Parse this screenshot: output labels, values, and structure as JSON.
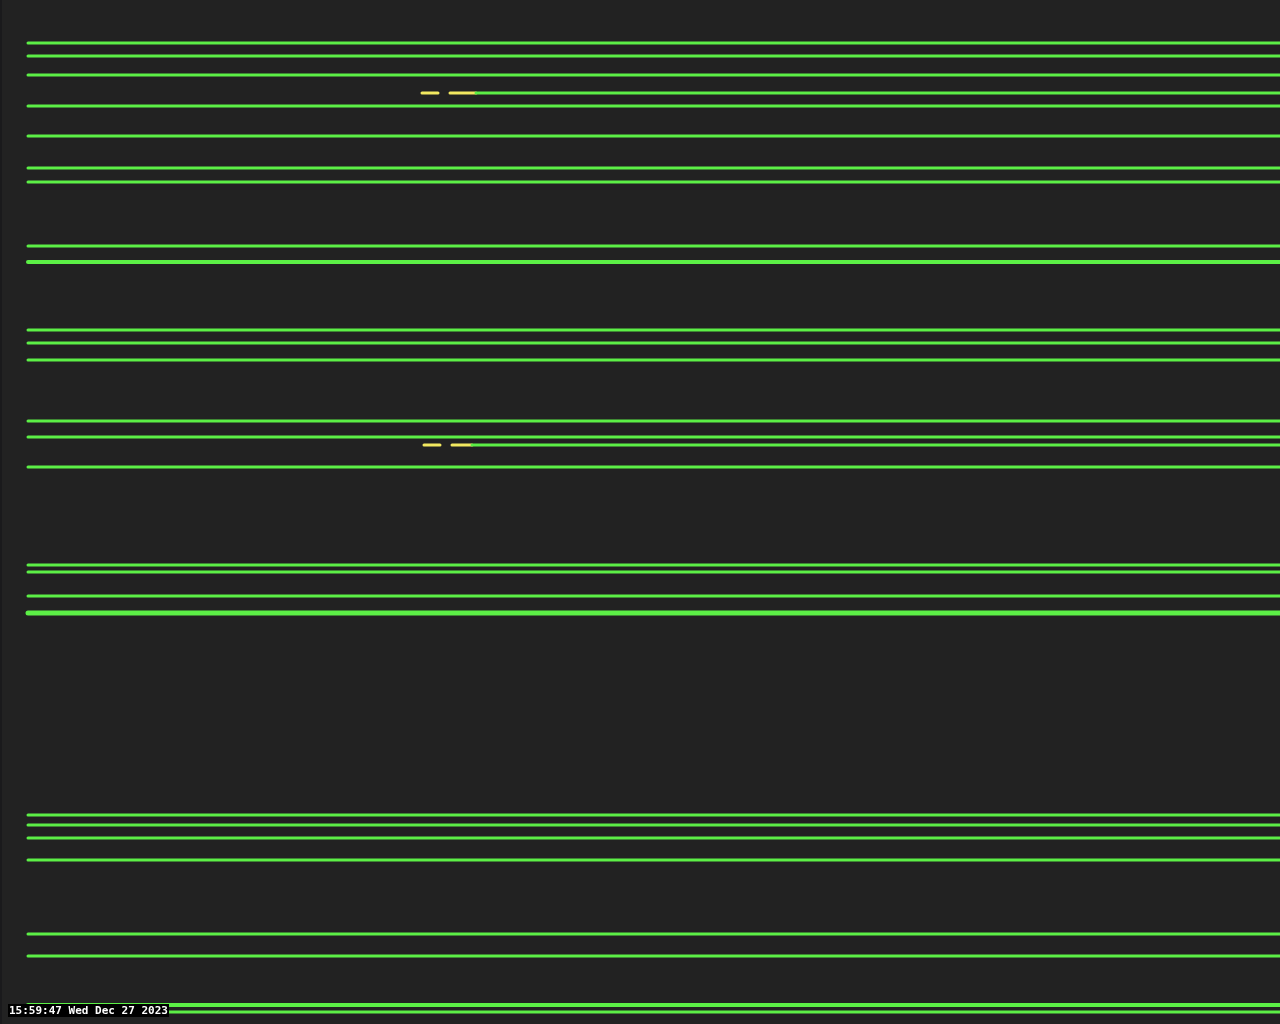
{
  "timestamp": "15:59:47 Wed Dec 27 2023"
}
